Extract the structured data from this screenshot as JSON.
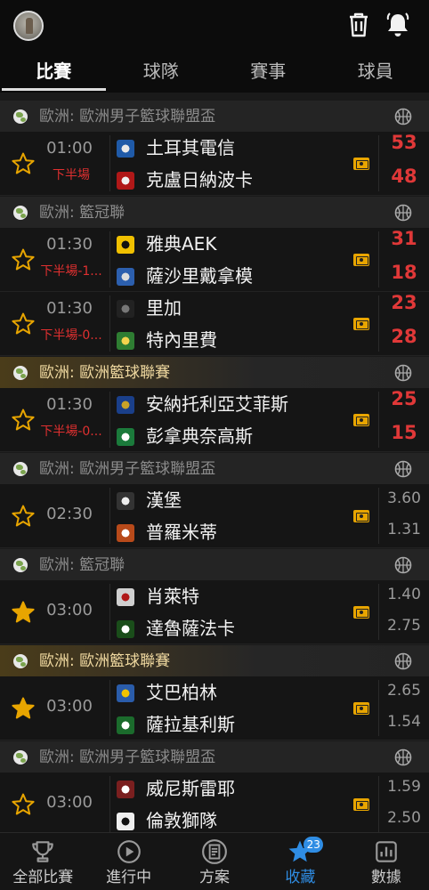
{
  "header": {
    "avatar_icon": "user-avatar",
    "actions": [
      "trash-icon",
      "bell-icon"
    ]
  },
  "tabs": [
    {
      "label": "比賽",
      "active": true
    },
    {
      "label": "球隊",
      "active": false
    },
    {
      "label": "賽事",
      "active": false
    },
    {
      "label": "球員",
      "active": false
    }
  ],
  "leagues": [
    {
      "name": "歐洲: 歐洲男子籃球聯盟盃",
      "highlight": false,
      "matches": [
        {
          "favorited": false,
          "time": "01:00",
          "status": "下半場",
          "home": "土耳其電信",
          "away": "克盧日納波卡",
          "home_score": "53",
          "away_score": "48"
        }
      ]
    },
    {
      "name": "歐洲: 籃冠聯",
      "highlight": false,
      "matches": [
        {
          "favorited": false,
          "time": "01:30",
          "status": "下半場-1...",
          "home": "雅典AEK",
          "away": "薩沙里戴拿模",
          "home_score": "31",
          "away_score": "18"
        },
        {
          "favorited": false,
          "time": "01:30",
          "status": "下半場-0...",
          "home": "里加",
          "away": "特內里費",
          "home_score": "23",
          "away_score": "28"
        }
      ]
    },
    {
      "name": "歐洲: 歐洲籃球聯賽",
      "highlight": true,
      "matches": [
        {
          "favorited": false,
          "time": "01:30",
          "status": "下半場-0...",
          "home": "安納托利亞艾菲斯",
          "away": "彭拿典奈高斯",
          "home_score": "25",
          "away_score": "15"
        }
      ]
    },
    {
      "name": "歐洲: 歐洲男子籃球聯盟盃",
      "highlight": false,
      "matches": [
        {
          "favorited": false,
          "time": "02:30",
          "status": "",
          "home": "漢堡",
          "away": "普羅米蒂",
          "home_odd": "3.60",
          "away_odd": "1.31"
        }
      ]
    },
    {
      "name": "歐洲: 籃冠聯",
      "highlight": false,
      "matches": [
        {
          "favorited": true,
          "time": "03:00",
          "status": "",
          "home": "肖萊特",
          "away": "達魯薩法卡",
          "home_odd": "1.40",
          "away_odd": "2.75"
        }
      ]
    },
    {
      "name": "歐洲: 歐洲籃球聯賽",
      "highlight": true,
      "matches": [
        {
          "favorited": true,
          "time": "03:00",
          "status": "",
          "home": "艾巴柏林",
          "away": "薩拉基利斯",
          "home_odd": "2.65",
          "away_odd": "1.54"
        }
      ]
    },
    {
      "name": "歐洲: 歐洲男子籃球聯盟盃",
      "highlight": false,
      "matches": [
        {
          "favorited": false,
          "time": "03:00",
          "status": "",
          "home": "威尼斯雷耶",
          "away": "倫敦獅隊",
          "home_odd": "1.59",
          "away_odd": "2.50"
        }
      ]
    }
  ],
  "bottom_nav": [
    {
      "label": "全部比賽",
      "icon": "trophy-icon",
      "active": false
    },
    {
      "label": "進行中",
      "icon": "play-icon",
      "active": false
    },
    {
      "label": "方案",
      "icon": "document-icon",
      "active": false
    },
    {
      "label": "收藏",
      "icon": "star-icon",
      "active": true,
      "badge": "23"
    },
    {
      "label": "數據",
      "icon": "bar-chart-icon",
      "active": false
    }
  ],
  "colors": {
    "live_score": "#e03838",
    "accent": "#2f8de4",
    "star_gold": "#e8a500"
  }
}
